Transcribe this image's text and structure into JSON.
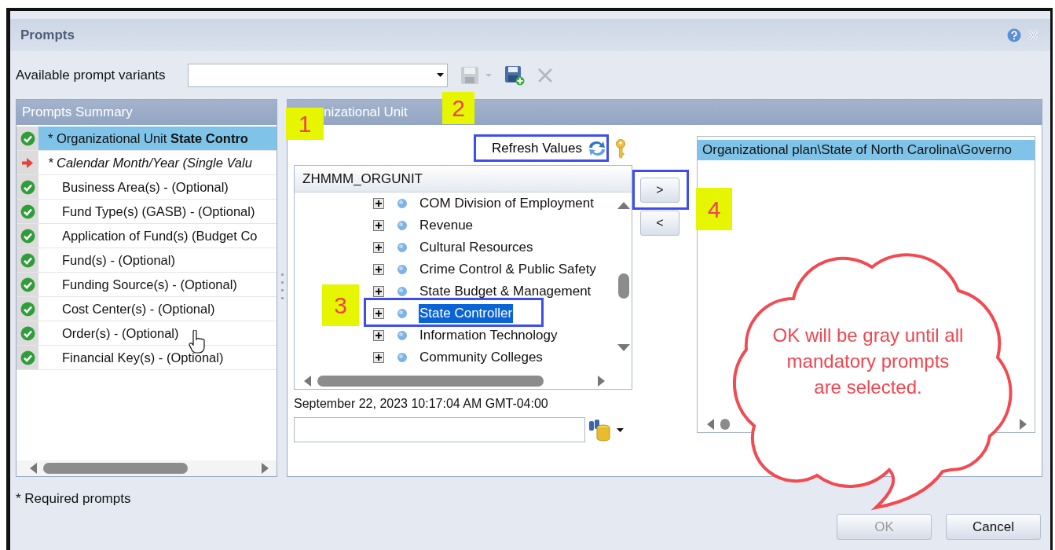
{
  "window": {
    "title": "Prompts"
  },
  "toolbar": {
    "label": "Available prompt variants"
  },
  "summary": {
    "title": "Prompts Summary",
    "items": [
      {
        "text": "* Organizational Unit **State Contro**",
        "kind": "complete",
        "required": true,
        "italic": false,
        "selected": true
      },
      {
        "text": "* Calendar Month/Year (Single Valu",
        "kind": "missing",
        "required": true,
        "italic": true,
        "selected": false
      },
      {
        "text": "Business Area(s) - (Optional)",
        "kind": "complete",
        "required": false,
        "italic": false,
        "selected": false
      },
      {
        "text": "Fund Type(s) (GASB) - (Optional)",
        "kind": "complete",
        "required": false,
        "italic": false,
        "selected": false
      },
      {
        "text": "Application of Fund(s) (Budget Co",
        "kind": "complete",
        "required": false,
        "italic": false,
        "selected": false
      },
      {
        "text": "Fund(s) - (Optional)",
        "kind": "complete",
        "required": false,
        "italic": false,
        "selected": false
      },
      {
        "text": "Funding Source(s) - (Optional)",
        "kind": "complete",
        "required": false,
        "italic": false,
        "selected": false
      },
      {
        "text": "Cost Center(s) - (Optional)",
        "kind": "complete",
        "required": false,
        "italic": false,
        "selected": false
      },
      {
        "text": "Order(s) - (Optional)",
        "kind": "complete",
        "required": false,
        "italic": false,
        "selected": false
      },
      {
        "text": "Financial Key(s) - (Optional)",
        "kind": "complete",
        "required": false,
        "italic": false,
        "selected": false
      }
    ]
  },
  "prompt": {
    "title": "nizational Unit",
    "refresh_label": "Refresh Values",
    "tree_header": "ZHMMM_ORGUNIT",
    "nodes": [
      {
        "label": "COM Division of Employment",
        "expanded": false,
        "selected": false
      },
      {
        "label": "Revenue",
        "expanded": false,
        "selected": false
      },
      {
        "label": "Cultural Resources",
        "expanded": false,
        "selected": false
      },
      {
        "label": "Crime Control & Public Safety",
        "expanded": false,
        "selected": false
      },
      {
        "label": "State Budget & Management",
        "expanded": false,
        "selected": false
      },
      {
        "label": "State Controller",
        "expanded": false,
        "selected": true
      },
      {
        "label": "Information Technology",
        "expanded": false,
        "selected": false
      },
      {
        "label": "Community Colleges",
        "expanded": false,
        "selected": false
      }
    ],
    "timestamp": "September 22, 2023 10:17:04 AM GMT-04:00",
    "move_buttons": [
      ">",
      "<"
    ],
    "chosen": [
      {
        "text": "Organizational plan\\State of North Carolina\\Governo",
        "selected": true
      }
    ]
  },
  "footer": {
    "note": "* Required prompts",
    "buttons": [
      {
        "label": "OK",
        "disabled": true
      },
      {
        "label": "Cancel",
        "disabled": false
      }
    ]
  },
  "annotations": [
    {
      "number": "1"
    },
    {
      "number": "2"
    },
    {
      "number": "3"
    },
    {
      "number": "4"
    }
  ],
  "callout": {
    "text": "OK will be gray until all mandatory prompts are selected."
  }
}
